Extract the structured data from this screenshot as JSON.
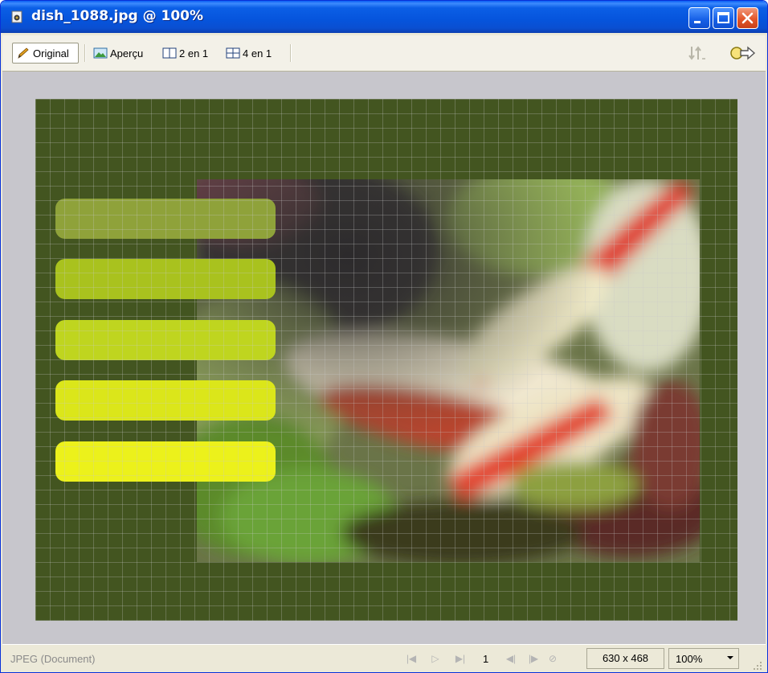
{
  "window": {
    "title": "dish_1088.jpg @ 100%"
  },
  "toolbar": {
    "tabs": [
      {
        "label": "Original",
        "icon": "pencil-icon",
        "active": true
      },
      {
        "label": "Aperçu",
        "icon": "preview-image-icon",
        "active": false
      },
      {
        "label": "2 en 1",
        "icon": "two-up-icon",
        "active": false
      },
      {
        "label": "4 en 1",
        "icon": "four-up-icon",
        "active": false
      }
    ],
    "right_icons": [
      "sort-icon",
      "export-icon"
    ]
  },
  "document": {
    "background_color": "#435520",
    "bars": [
      {
        "color": "#8fa23a"
      },
      {
        "color": "#a9c21e"
      },
      {
        "color": "#bfd51f"
      },
      {
        "color": "#dbe61a"
      },
      {
        "color": "#ecf11b"
      }
    ]
  },
  "status": {
    "format": "JPEG (Document)",
    "page": "1",
    "dimensions": "630 x 468",
    "zoom": "100%"
  }
}
